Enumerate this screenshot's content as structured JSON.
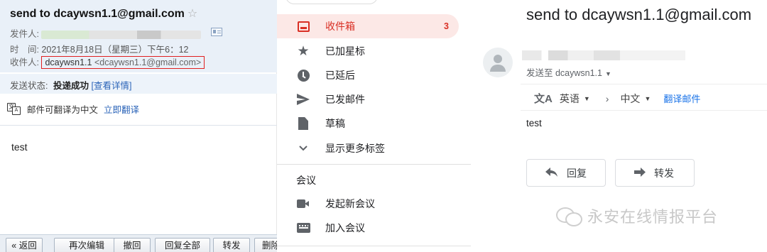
{
  "qqmail": {
    "subject": "send to dcaywsn1.1@gmail.com",
    "star": "☆",
    "from_label": "发件人:",
    "time_label": "时　间:",
    "time_value": "2021年8月18日（星期三）下午6：12",
    "to_label": "收件人:",
    "to_name": "dcaywsn1.1",
    "to_email": "<dcaywsn1.1@gmail.com>",
    "status_label": "发送状态:",
    "status_value": "投递成功",
    "status_link": "[查看详情]",
    "translate_text": "邮件可翻译为中文",
    "translate_link": "立即翻译",
    "body": "test",
    "toolbar": [
      "« 返回",
      "再次编辑",
      "撤回",
      "回复全部",
      "转发",
      "删除"
    ]
  },
  "gmail_nav": {
    "items": [
      {
        "label": "收件箱",
        "icon": "inbox-icon",
        "count": "3",
        "active": true
      },
      {
        "label": "已加星标",
        "icon": "star-icon"
      },
      {
        "label": "已延后",
        "icon": "clock-icon"
      },
      {
        "label": "已发邮件",
        "icon": "send-icon"
      },
      {
        "label": "草稿",
        "icon": "draft-icon"
      },
      {
        "label": "显示更多标签",
        "icon": "chevron-down-icon"
      }
    ],
    "meet_header": "会议",
    "meet_items": [
      {
        "label": "发起新会议",
        "icon": "video-camera-icon"
      },
      {
        "label": "加入会议",
        "icon": "keyboard-icon"
      }
    ]
  },
  "gmail_msg": {
    "subject": "send to dcaywsn1.1@gmail.com",
    "sent_to": "发送至 dcaywsn1.1",
    "lang_from": "英语",
    "lang_to": "中文",
    "translate_link": "翻译邮件",
    "body": "test",
    "reply_label": "回复",
    "forward_label": "转发"
  },
  "watermark": "永安在线情报平台"
}
